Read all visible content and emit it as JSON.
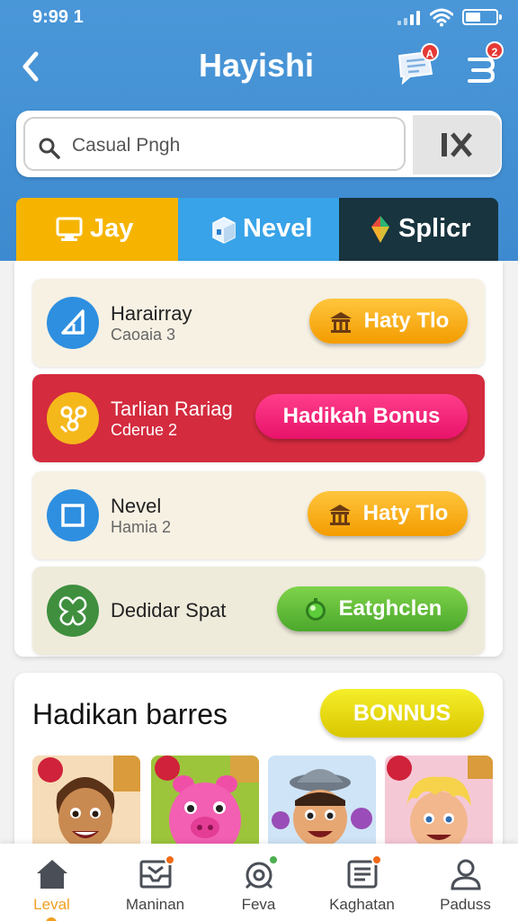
{
  "status_bar": {
    "time": "9:99 1"
  },
  "header": {
    "title": "Hayishi",
    "message_badge": "A",
    "menu_badge": "2"
  },
  "search": {
    "placeholder": "Casual Pngh"
  },
  "tabs": [
    {
      "label": "Jay",
      "icon": "monitor-icon",
      "color": "#f6b400"
    },
    {
      "label": "Nevel",
      "icon": "box-icon",
      "color": "#38a3e8"
    },
    {
      "label": "Splicr",
      "icon": "kite-icon",
      "color": "#18343e"
    }
  ],
  "rows": [
    {
      "title": "Harairray",
      "subtitle": "Caoaia 3",
      "button": "Haty Tlo",
      "icon": "triangle-icon"
    },
    {
      "title": "Tarlian Rariag",
      "subtitle": "Cderue 2",
      "button": "Hadikah Bonus",
      "icon": "network-icon"
    },
    {
      "title": "Nevel",
      "subtitle": "Hamia 2",
      "button": "Haty Tlo",
      "icon": "square-icon"
    },
    {
      "title": "Dedidar Spat",
      "subtitle": "",
      "button": "Eatghclen",
      "icon": "clover-icon"
    }
  ],
  "bonus_section": {
    "title": "Hadikan barres",
    "button": "BONNUS",
    "thumbnails": [
      "boy-character-thumbnail",
      "pink-pig-thumbnail",
      "hat-boy-thumbnail",
      "blonde-boy-thumbnail"
    ]
  },
  "bottom_nav": [
    {
      "label": "Leval",
      "icon": "home-icon",
      "active": true
    },
    {
      "label": "Maninan",
      "icon": "inbox-icon",
      "active": false
    },
    {
      "label": "Feva",
      "icon": "compass-icon",
      "active": false
    },
    {
      "label": "Kaghatan",
      "icon": "document-icon",
      "active": false
    },
    {
      "label": "Paduss",
      "icon": "person-icon",
      "active": false
    }
  ],
  "colors": {
    "header_blue": "#4292d4",
    "orange": "#f6a800",
    "pink": "#e8136a",
    "green": "#5cb832",
    "red_row": "#d42b3e",
    "yellow": "#e6d800",
    "nav_active": "#f0a020"
  }
}
